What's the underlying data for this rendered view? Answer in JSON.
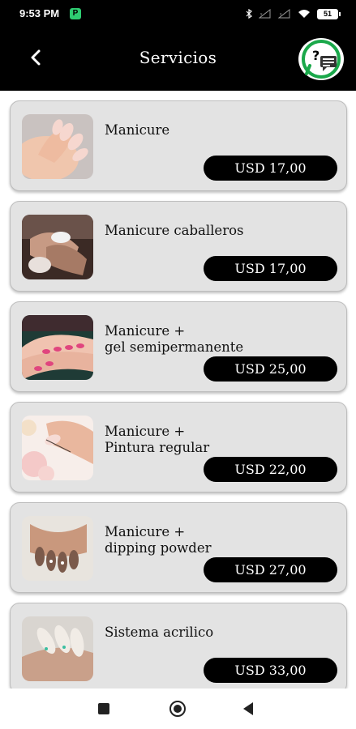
{
  "status_bar": {
    "time": "9:53 PM",
    "app_badge": "P",
    "battery": "51"
  },
  "header": {
    "title": "Servicios",
    "back_icon": "arrow-left-icon",
    "help_icon": "chat-help-icon"
  },
  "services": [
    {
      "name": "Manicure",
      "price": "USD 17,00"
    },
    {
      "name": "Manicure caballeros",
      "price": "USD 17,00"
    },
    {
      "name": "Manicure +\ngel semipermanente",
      "price": "USD 25,00"
    },
    {
      "name": "Manicure +\nPintura regular",
      "price": "USD 22,00"
    },
    {
      "name": "Manicure +\ndipping powder",
      "price": "USD 27,00"
    },
    {
      "name": "Sistema acrilico",
      "price": "USD 33,00"
    }
  ],
  "nav": {
    "recent_icon": "square-recent-apps-icon",
    "home_icon": "circle-home-icon",
    "back_icon": "triangle-back-icon"
  }
}
